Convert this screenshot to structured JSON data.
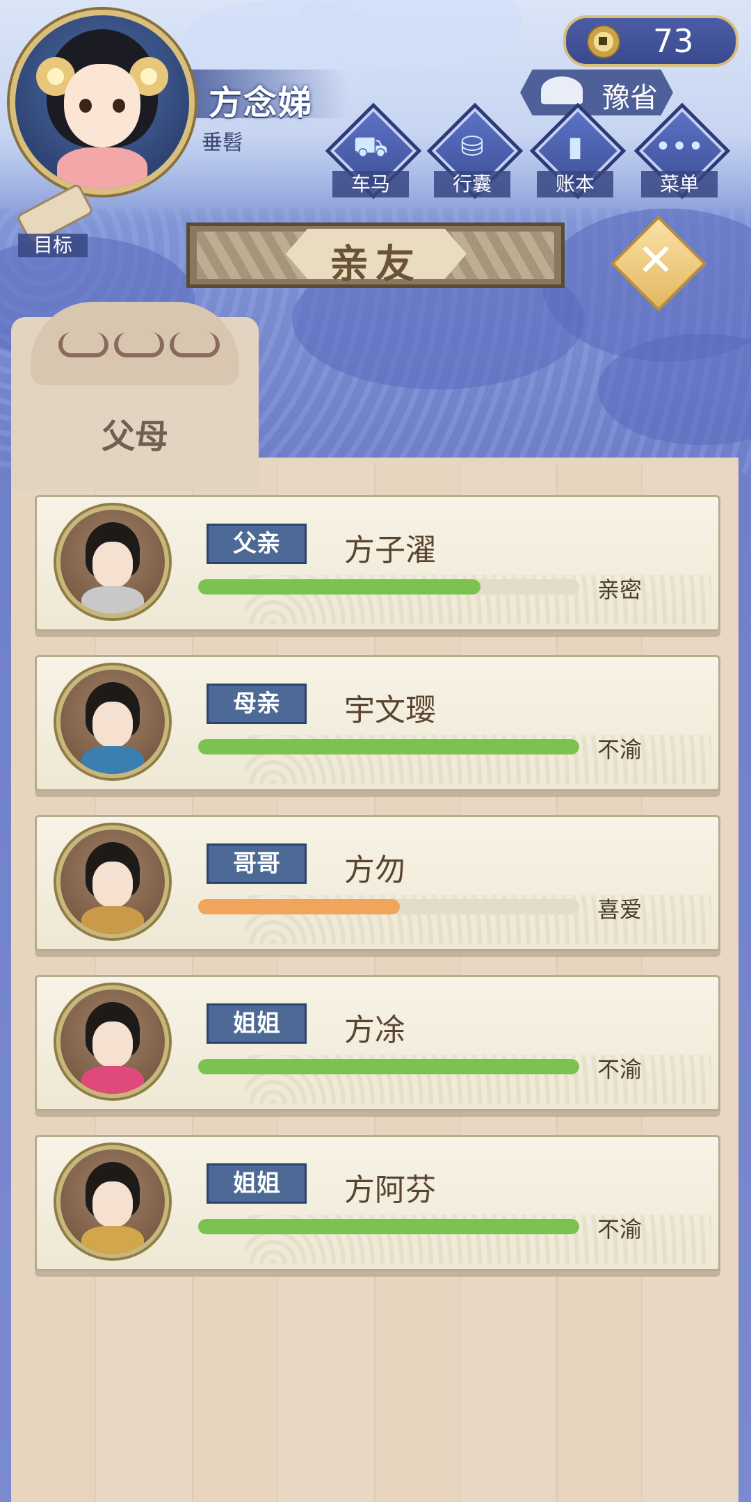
{
  "header": {
    "player_name": "方念娣",
    "player_title": "垂髫",
    "coins": "73",
    "location": "豫省",
    "title": "亲友",
    "close_symbol": "✕"
  },
  "menu": {
    "items": [
      {
        "label": "车马",
        "icon": "carriage-icon"
      },
      {
        "label": "行囊",
        "icon": "bag-icon"
      },
      {
        "label": "账本",
        "icon": "ledger-icon"
      },
      {
        "label": "菜单",
        "icon": "menu-icon"
      }
    ],
    "goal_label": "目标"
  },
  "tab": {
    "label": "父母"
  },
  "relatives": [
    {
      "role": "父亲",
      "name": "方子濯",
      "relation": "亲密",
      "affinity": 0.74,
      "bar_color": "#7cc24e"
    },
    {
      "role": "母亲",
      "name": "宇文璎",
      "relation": "不渝",
      "affinity": 1.0,
      "bar_color": "#7cc24e"
    },
    {
      "role": "哥哥",
      "name": "方勿",
      "relation": "喜爱",
      "affinity": 0.53,
      "bar_color": "#f0a55c"
    },
    {
      "role": "姐姐",
      "name": "方凃",
      "relation": "不渝",
      "affinity": 1.0,
      "bar_color": "#7cc24e"
    },
    {
      "role": "姐姐",
      "name": "方阿芬",
      "relation": "不渝",
      "affinity": 1.0,
      "bar_color": "#7cc24e"
    }
  ],
  "colors": {
    "role_badge": "#4d6a96",
    "panel": "#e3d3c1",
    "accent_gold": "#d7bf78"
  }
}
